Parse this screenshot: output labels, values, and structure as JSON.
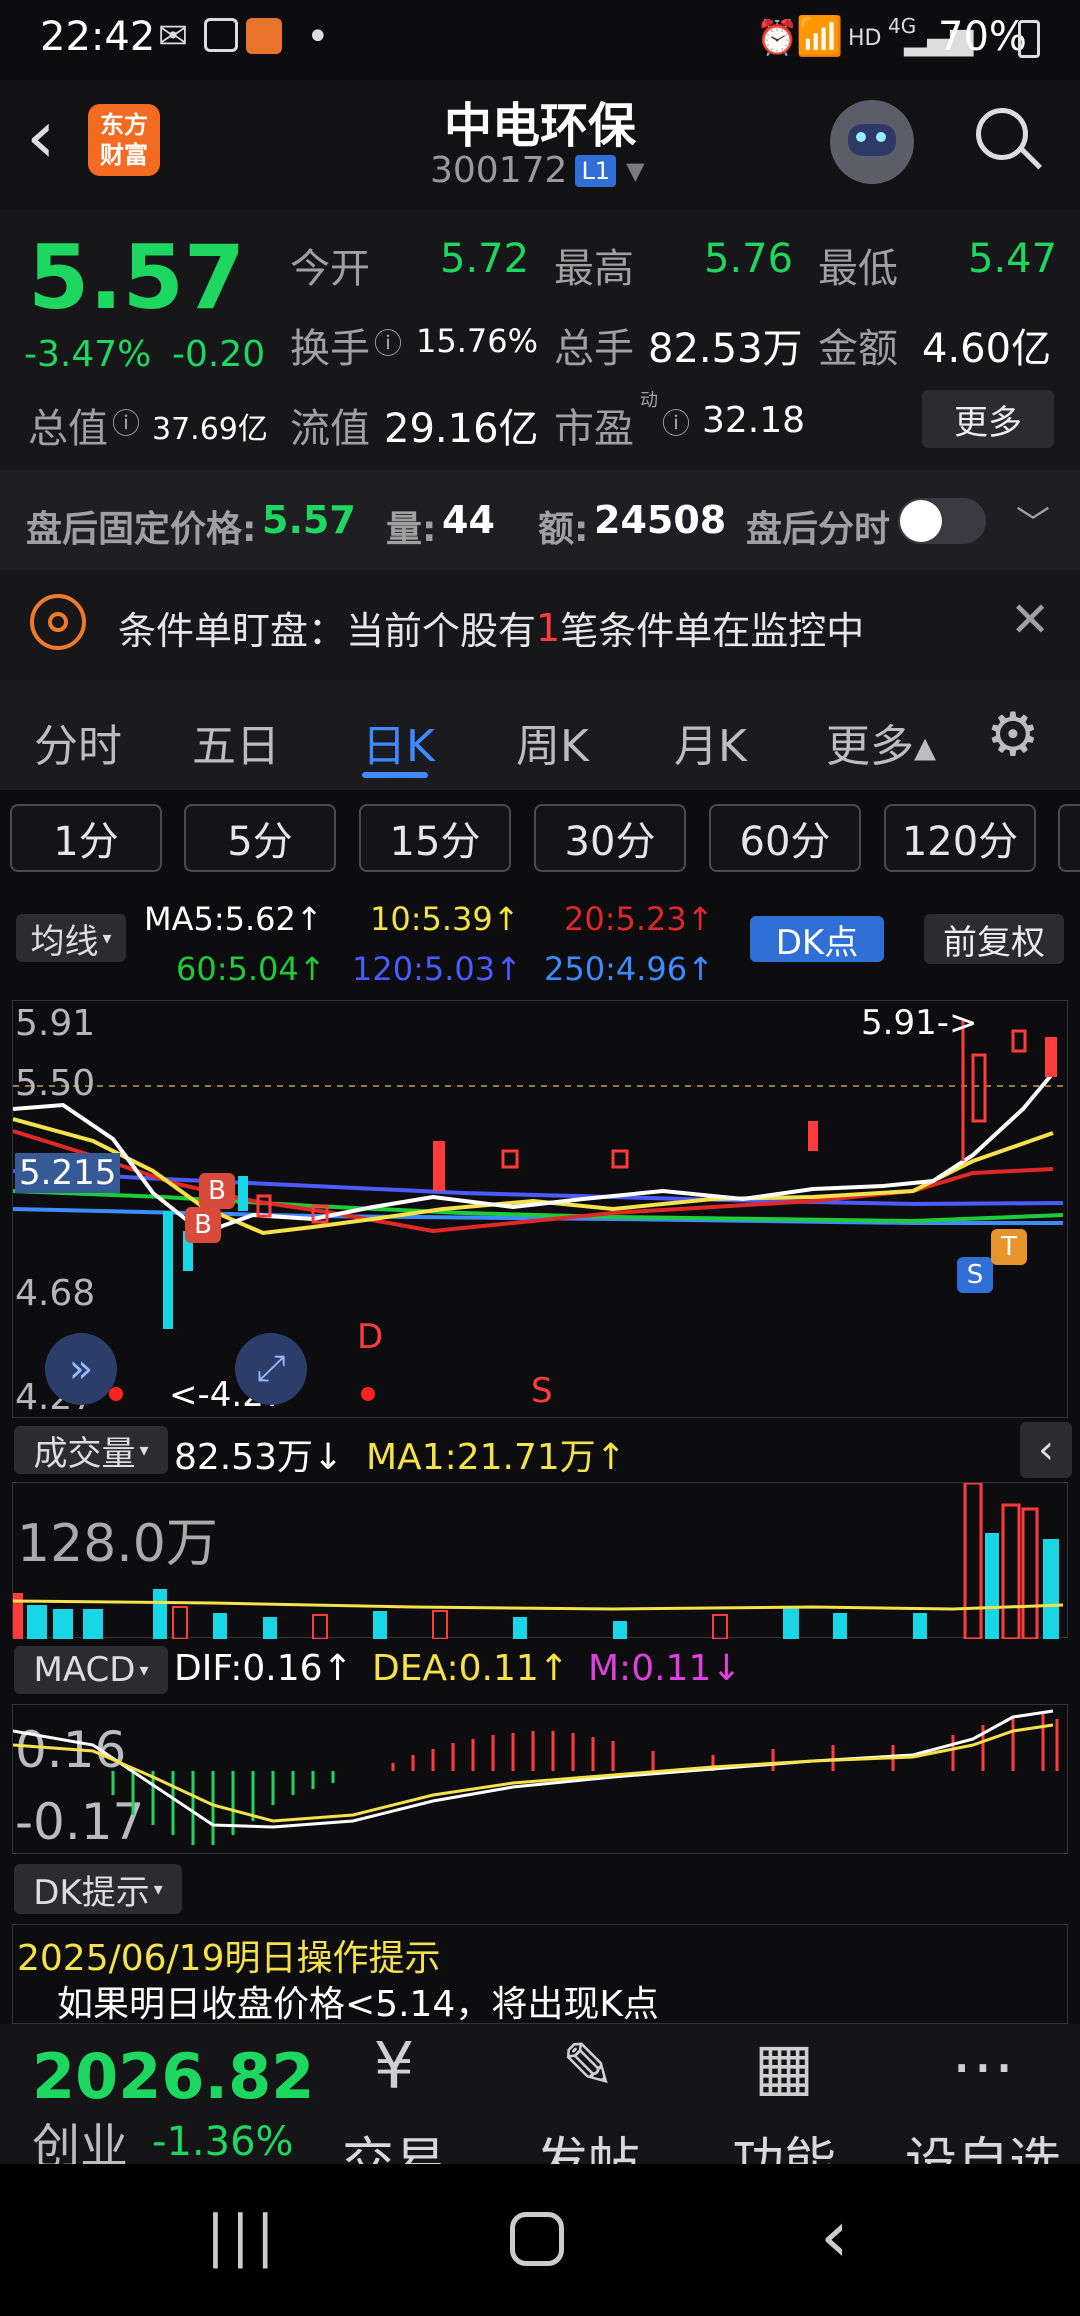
{
  "status_bar": {
    "time": "22:42",
    "battery": "70%",
    "network": "HD",
    "network_gen": "4G"
  },
  "header": {
    "logo_line1": "东方",
    "logo_line2": "财富",
    "stock_name": "中电环保",
    "stock_code": "300172",
    "level_badge": "L1"
  },
  "quote": {
    "price": "5.57",
    "change_pct": "-3.47%",
    "change_abs": "-0.20",
    "open_label": "今开",
    "open": "5.72",
    "high_label": "最高",
    "high": "5.76",
    "low_label": "最低",
    "low": "5.47",
    "turnover_label": "换手",
    "turnover": "15.76%",
    "volume_label": "总手",
    "volume": "82.53万",
    "amount_label": "金额",
    "amount": "4.60亿",
    "mktcap_label": "总值",
    "mktcap": "37.69亿",
    "float_label": "流值",
    "float": "29.16亿",
    "pe_label": "市盈",
    "pe_sup": "动",
    "pe": "32.18",
    "more_button": "更多"
  },
  "after_hours": {
    "label": "盘后固定价格:",
    "price": "5.57",
    "vol_label": "量:",
    "vol": "44",
    "amt_label": "额:",
    "amt": "24508",
    "timeline_label": "盘后分时"
  },
  "notice": {
    "text_before": "条件单盯盘：当前个股有",
    "count": "1",
    "text_after": "笔条件单在监控中"
  },
  "tabs": [
    "分时",
    "五日",
    "日K",
    "周K",
    "月K",
    "更多▴"
  ],
  "periods": [
    "1分",
    "5分",
    "15分",
    "30分",
    "60分",
    "120分"
  ],
  "ma_bar": {
    "selector": "均线",
    "ma5": "MA5:5.62↑",
    "ma10": "10:5.39↑",
    "ma20": "20:5.23↑",
    "ma60": "60:5.04↑",
    "ma120": "120:5.03↑",
    "ma250": "250:4.96↑",
    "dk_button": "DK点",
    "adjust_button": "前复权"
  },
  "kline": {
    "y_labels": [
      "5.91",
      "5.50",
      "4.68",
      "4.27"
    ],
    "current_tag": "5.215",
    "high_tag": "5.91->",
    "low_tag": "<-4.27",
    "markers": [
      "B",
      "B",
      "D",
      "S",
      "S",
      "T"
    ]
  },
  "volume_bar": {
    "selector": "成交量",
    "vol": "82.53万↓",
    "ma1": "MA1:21.71万↑",
    "max_label": "128.0万"
  },
  "macd_bar": {
    "selector": "MACD",
    "dif": "DIF:0.16↑",
    "dea": "DEA:0.11↑",
    "m": "M:0.11↓",
    "top_label": "0.16",
    "bottom_label": "-0.17"
  },
  "dk_tips": {
    "selector": "DK提示",
    "date_line": "2025/06/19明日操作提示",
    "tip": "如果明日收盘价格<5.14，将出现K点"
  },
  "index_ticker": {
    "value": "2026.82",
    "name": "创业",
    "change": "-1.36%"
  },
  "bottom_nav": [
    "交易",
    "发帖",
    "功能",
    "设自选"
  ],
  "colors": {
    "up": "#ff3b3b",
    "down": "#1ed760",
    "cyan": "#18d6e6",
    "yellow": "#f5e14a",
    "accent": "#3d8bff"
  }
}
